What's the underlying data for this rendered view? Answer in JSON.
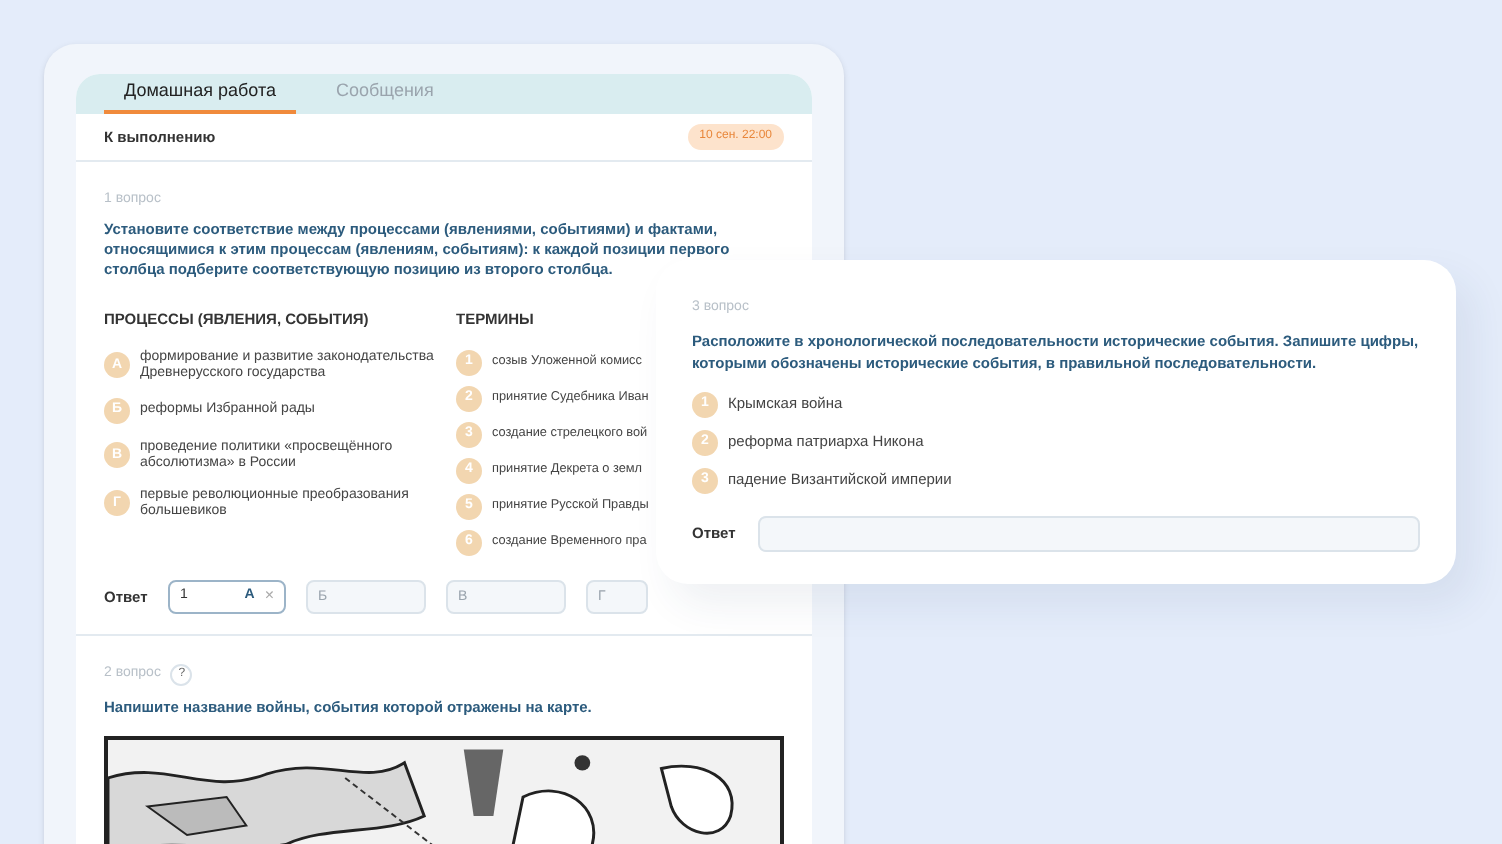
{
  "tabs": [
    {
      "label": "Домашная работа",
      "selected": true
    },
    {
      "label": "Сообщения",
      "selected": false
    }
  ],
  "status": {
    "label": "К выполнению",
    "deadline": "10 сен. 22:00"
  },
  "question1": {
    "number": "1 вопрос",
    "prompt": "Установите соответствие между процессами (явлениями, событиями) и фактами, относящимися к этим процессам (явлениям, событиям): к каждой позиции первого столбца подберите соответствующую позицию из второго столбца.",
    "processes": {
      "heading": "ПРОЦЕССЫ (ЯВЛЕНИЯ, СОБЫТИЯ)",
      "items": [
        {
          "marker": "А",
          "text": "формирование и развитие законодательства Древнерусского государства"
        },
        {
          "marker": "Б",
          "text": "реформы Избранной рады"
        },
        {
          "marker": "В",
          "text": "проведение политики «просвещённого абсолютизма» в России"
        },
        {
          "marker": "Г",
          "text": "первые революционные преобразования большевиков"
        }
      ]
    },
    "terms": {
      "heading": "ТЕРМИНЫ",
      "items": [
        {
          "marker": "1",
          "text": "созыв Уложенной комисс"
        },
        {
          "marker": "2",
          "text": "принятие Судебника Иван"
        },
        {
          "marker": "3",
          "text": "создание стрелецкого вой"
        },
        {
          "marker": "4",
          "text": "принятие Декрета о земл"
        },
        {
          "marker": "5",
          "text": "принятие Русской Правды"
        },
        {
          "marker": "6",
          "text": "создание Временного пра"
        }
      ]
    },
    "answer": {
      "label": "Ответ",
      "fields": [
        {
          "value": "1",
          "letter": "А",
          "clear": "×"
        },
        {
          "placeholder": "Б"
        },
        {
          "placeholder": "В"
        },
        {
          "placeholder": "Г"
        }
      ]
    }
  },
  "question2": {
    "number": "2 вопрос",
    "help": "?",
    "prompt": "Напишите название войны, события которой отражены на карте."
  },
  "question3": {
    "number": "3 вопрос",
    "prompt": "Расположите в хронологической последовательности исторические события. Запишите цифры, которыми обозначены исторические события, в правильной последовательности.",
    "items": [
      {
        "marker": "1",
        "text": "Крымская война"
      },
      {
        "marker": "2",
        "text": "реформа патриарха Никона"
      },
      {
        "marker": "3",
        "text": "падение Византийской империи"
      }
    ],
    "answer": {
      "label": "Ответ"
    }
  }
}
